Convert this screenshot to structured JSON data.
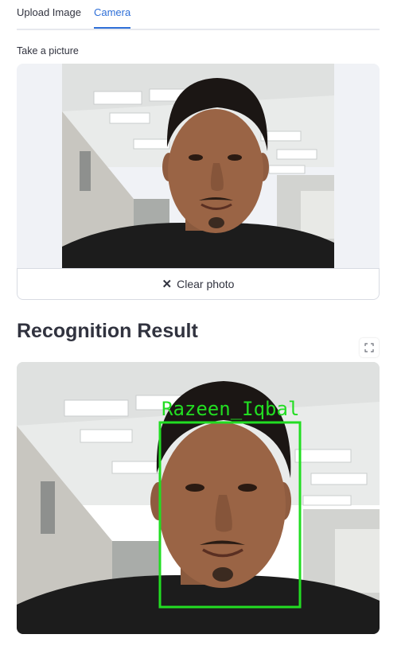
{
  "tabs": [
    {
      "label": "Upload Image",
      "active": false
    },
    {
      "label": "Camera",
      "active": true
    }
  ],
  "camera": {
    "label": "Take a picture",
    "clear_button_label": "Clear photo"
  },
  "result": {
    "title": "Recognition Result",
    "detected_name": "Razeen_Iqbal",
    "box_color": "#22dd22"
  },
  "icons": {
    "clear": "close-icon",
    "fullscreen": "fullscreen-icon"
  },
  "colors": {
    "accent": "#2e6fd8",
    "text": "#31333f",
    "detection_box": "#22dd22"
  }
}
